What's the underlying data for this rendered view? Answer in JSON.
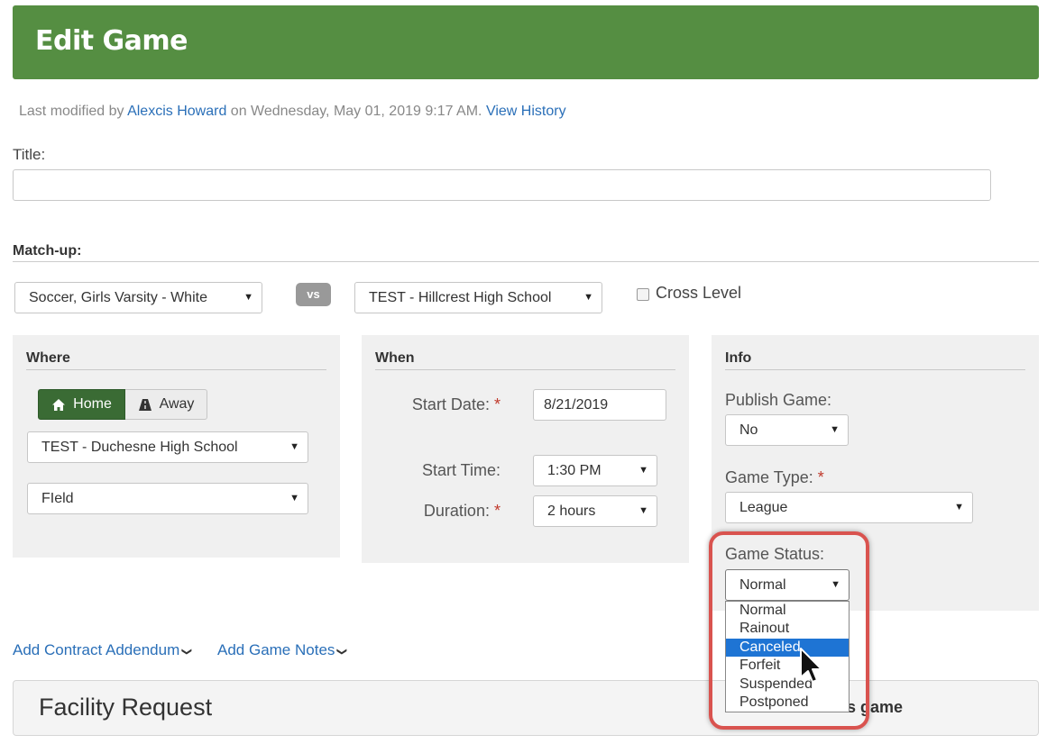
{
  "header": {
    "title": "Edit Game"
  },
  "modified": {
    "prefix": "Last modified by",
    "user": "Alexcis Howard",
    "middle": "on Wednesday, May 01, 2019 9:17 AM.",
    "history_link": "View History"
  },
  "title_field": {
    "label": "Title:",
    "value": ""
  },
  "matchup": {
    "label": "Match-up:",
    "team": "Soccer, Girls Varsity - White",
    "vs": "vs",
    "opponent": "TEST - Hillcrest High School",
    "cross_level": "Cross Level"
  },
  "where": {
    "title": "Where",
    "home": "Home",
    "away": "Away",
    "location": "TEST - Duchesne High School",
    "facility": "FIeld"
  },
  "when": {
    "title": "When",
    "start_date_label": "Start Date:",
    "start_date": "8/21/2019",
    "start_time_label": "Start Time:",
    "start_time": "1:30 PM",
    "duration_label": "Duration:",
    "duration": "2 hours",
    "required_mark": "*"
  },
  "info": {
    "title": "Info",
    "publish_label": "Publish Game:",
    "publish_value": "No",
    "type_label": "Game Type:",
    "type_value": "League",
    "status_label": "Game Status:",
    "status_value": "Normal",
    "status_options": [
      "Normal",
      "Rainout",
      "Canceled",
      "Forfeit",
      "Suspended",
      "Postponed"
    ],
    "highlighted_option": "Canceled"
  },
  "links": {
    "contract": "Add Contract Addendum",
    "notes": "Add Game Notes"
  },
  "facility": {
    "title": "Facility Request",
    "right_text": "r this game"
  },
  "colors": {
    "header_bg": "#558e42",
    "home_btn": "#3a6b34",
    "link": "#2a6fb8",
    "highlight_border": "#d9534f",
    "selected_option": "#1e74d4"
  }
}
